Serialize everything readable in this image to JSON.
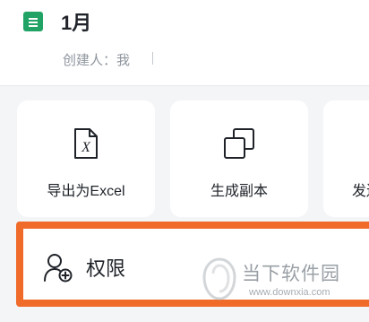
{
  "document": {
    "title": "1月",
    "creator_label": "创建人：我"
  },
  "actions": [
    {
      "label": "导出为Excel",
      "icon": "excel-file-icon"
    },
    {
      "label": "生成副本",
      "icon": "copy-icon"
    },
    {
      "label": "发送",
      "icon": "send-icon"
    }
  ],
  "permission": {
    "label": "权限",
    "icon": "user-add-icon",
    "highlight_color": "#f06a2a"
  },
  "watermark": {
    "name": "当下软件园",
    "url": "www.downxia.com"
  },
  "colors": {
    "brand_green": "#21a366",
    "highlight_orange": "#f06a2a"
  }
}
